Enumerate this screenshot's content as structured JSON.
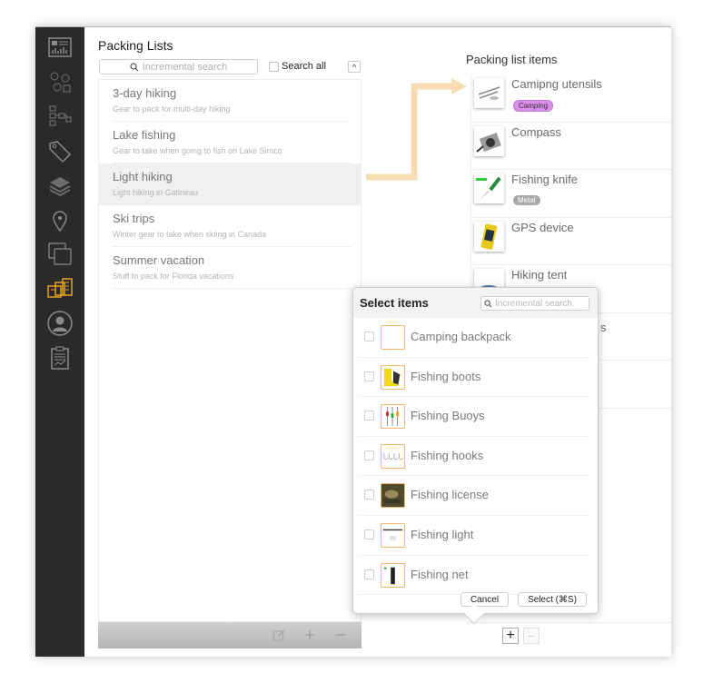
{
  "sidebar": {
    "items": [
      {
        "icon": "dashboard-icon",
        "active": false
      },
      {
        "icon": "gear-collection-icon",
        "active": false
      },
      {
        "icon": "hierarchy-icon",
        "active": false
      },
      {
        "icon": "tag-icon",
        "active": false
      },
      {
        "icon": "layers-icon",
        "active": false
      },
      {
        "icon": "location-pin-icon",
        "active": false
      },
      {
        "icon": "windows-icon",
        "active": false
      },
      {
        "icon": "packing-lists-icon",
        "active": true
      },
      {
        "icon": "user-icon",
        "active": false
      },
      {
        "icon": "clipboard-report-icon",
        "active": false
      }
    ],
    "active_color": "#e8a21c",
    "icon_color": "#8a8a8a"
  },
  "left_panel": {
    "title": "Packing Lists",
    "search_placeholder": "Incremental search",
    "search_all_label": "Search all",
    "search_all_checked": false,
    "collapse_label": "^",
    "lists": [
      {
        "title": "3-day hiking",
        "subtitle": "Gear to pack for multi-day hiking",
        "selected": false
      },
      {
        "title": "Lake fishing",
        "subtitle": "Gear to take when going to fish on Lake Simco",
        "selected": false
      },
      {
        "title": "Light hiking",
        "subtitle": "Light hiking in Gatineau",
        "selected": true
      },
      {
        "title": "Ski trips",
        "subtitle": "Winter gear to take when skiing in Canada",
        "selected": false
      },
      {
        "title": "Summer vacation",
        "subtitle": "Stuff to pack for Florida vacations",
        "selected": false
      }
    ],
    "footer": {
      "edit": "edit-icon",
      "add": "+",
      "remove": "−"
    }
  },
  "right_panel": {
    "title": "Packing list items",
    "items": [
      {
        "title": "Camipng utensils",
        "tag": "Camping"
      },
      {
        "title": "Compass",
        "tag": null
      },
      {
        "title": "Fishing knife",
        "tag": "Metal"
      },
      {
        "title": "GPS device",
        "tag": null
      },
      {
        "title": "Hiking tent",
        "tag": null
      },
      {
        "title": "s",
        "tag": null
      },
      {
        "title": "",
        "tag": null
      },
      {
        "title": "",
        "tag": null
      }
    ],
    "footer": {
      "add": "+",
      "remove": "−"
    }
  },
  "popover": {
    "title": "Select items",
    "search_placeholder": "Incremental search",
    "items": [
      {
        "label": "Camping backpack",
        "checked": false
      },
      {
        "label": "Fishing boots",
        "checked": false
      },
      {
        "label": "Fishing Buoys",
        "checked": false
      },
      {
        "label": "Fishing hooks",
        "checked": false
      },
      {
        "label": "Fishing license",
        "checked": false
      },
      {
        "label": "Fishing light",
        "checked": false
      },
      {
        "label": "Fishing net",
        "checked": false
      }
    ],
    "cancel_label": "Cancel",
    "select_label": "Select (⌘S)"
  },
  "colors": {
    "arrow": "#f8dcb4",
    "accent": "#e8a21c",
    "tag_camping": "#d98ee8",
    "tag_metal": "#a9a9a9"
  }
}
